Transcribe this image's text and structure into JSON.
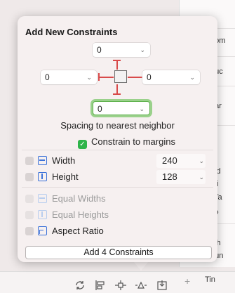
{
  "popover": {
    "title": "Add New Constraints",
    "top_value": "0",
    "left_value": "0",
    "right_value": "0",
    "bottom_value": "0",
    "spacing_label": "Spacing to nearest neighbor",
    "constrain_to_margins": "Constrain to margins",
    "width": {
      "label": "Width",
      "value": "240"
    },
    "height": {
      "label": "Height",
      "value": "128"
    },
    "equal_widths": "Equal Widths",
    "equal_heights": "Equal Heights",
    "aspect_ratio": "Aspect Ratio",
    "add_button": "Add 4 Constraints",
    "chevron": "⌄"
  },
  "background": {
    "rows": [
      "oom",
      "ouc",
      "oar",
      "lod",
      "nti",
      "Ta",
      "tio",
      "lph",
      "oun"
    ],
    "tin": "Tin",
    "plus": "+"
  },
  "colors": {
    "accent_red": "#d84a4a",
    "focus_green": "#5fb24d",
    "icon_blue": "#3b72d9",
    "check_green": "#2fb44a"
  }
}
